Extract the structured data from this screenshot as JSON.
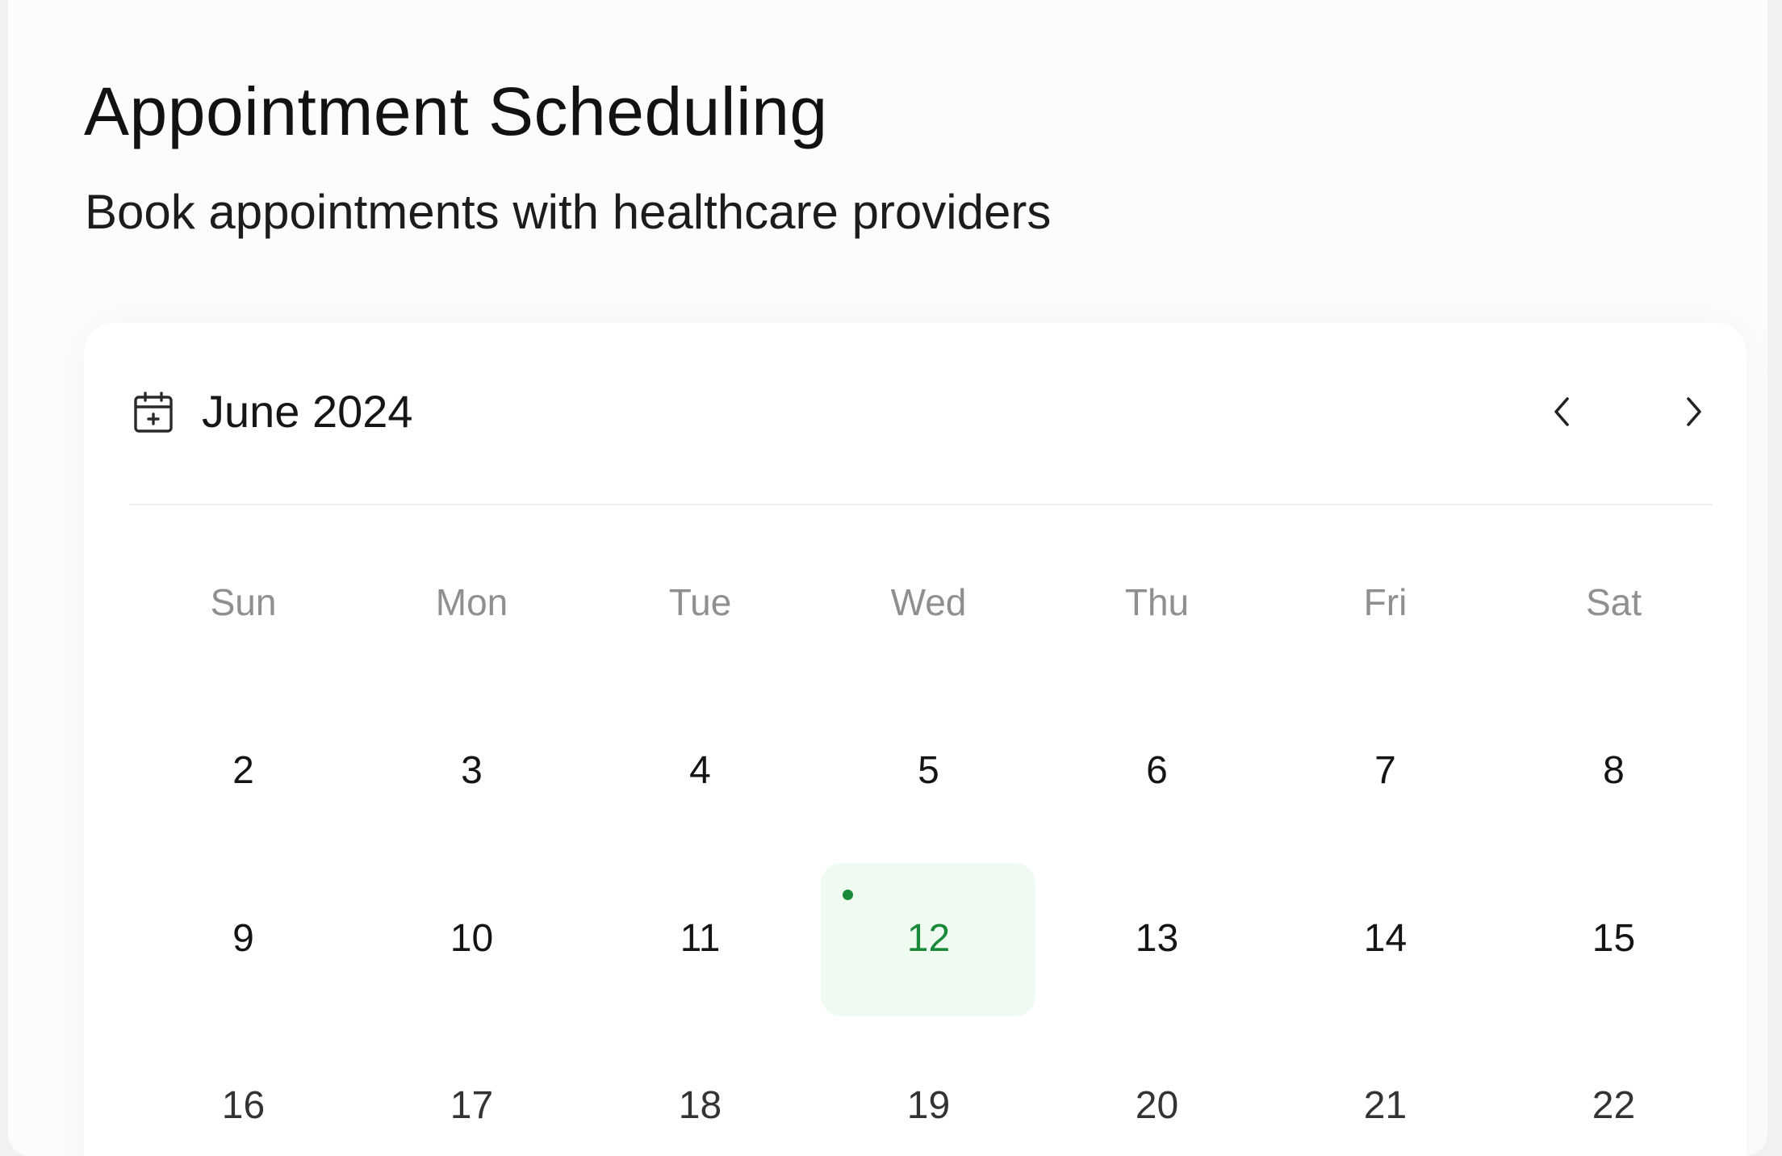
{
  "header": {
    "title": "Appointment Scheduling",
    "subtitle": "Book appointments with healthcare providers"
  },
  "calendar": {
    "month_label": "June 2024",
    "icons": {
      "month": "calendar-plus-icon",
      "prev": "chevron-left-icon",
      "next": "chevron-right-icon"
    },
    "weekdays": [
      "Sun",
      "Mon",
      "Tue",
      "Wed",
      "Thu",
      "Fri",
      "Sat"
    ],
    "weeks": [
      [
        "2",
        "3",
        "4",
        "5",
        "6",
        "7",
        "8"
      ],
      [
        "9",
        "10",
        "11",
        "12",
        "13",
        "14",
        "15"
      ],
      [
        "16",
        "17",
        "18",
        "19",
        "20",
        "21",
        "22"
      ]
    ],
    "selected_day": "12",
    "days_with_appointments": [
      "12"
    ],
    "colors": {
      "accent": "#1a8a3a",
      "selected_bg": "#effaf1",
      "weekday_text": "#8f8f8f"
    }
  }
}
